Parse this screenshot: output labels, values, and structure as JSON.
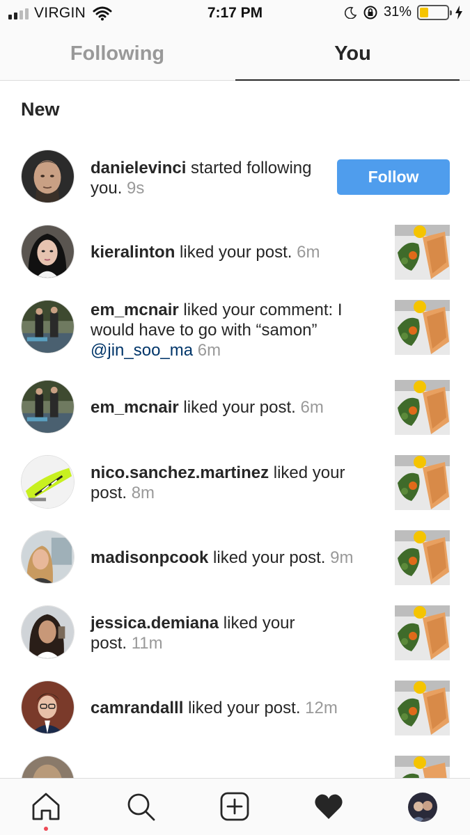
{
  "status_bar": {
    "carrier": "VIRGIN",
    "time": "7:17 PM",
    "battery_percent": "31%",
    "battery_level": 0.31,
    "battery_color": "#f5c400"
  },
  "tabs": {
    "following": "Following",
    "you": "You",
    "active": "You"
  },
  "section_title": "New",
  "notifications": [
    {
      "username": "danielevinci",
      "action": " started following you. ",
      "time": "9s",
      "button": "Follow",
      "avatar_icon": "user-photo",
      "accent": "#4f9ded"
    },
    {
      "username": "kieralinton",
      "action": " liked your post. ",
      "time": "6m",
      "thumb_icon": "food-post-thumbnail"
    },
    {
      "username": "em_mcnair",
      "action": " liked your comment: I would have to go with “samon” ",
      "mention": "@jin_soo_ma",
      "time": "6m",
      "thumb_icon": "food-post-thumbnail"
    },
    {
      "username": "em_mcnair",
      "action": " liked your post. ",
      "time": "6m",
      "thumb_icon": "food-post-thumbnail"
    },
    {
      "username": "nico.sanchez.martinez",
      "action": " liked your post. ",
      "time": "8m",
      "thumb_icon": "food-post-thumbnail"
    },
    {
      "username": "madisonpcook",
      "action": " liked your post. ",
      "time": "9m",
      "thumb_icon": "food-post-thumbnail"
    },
    {
      "username": "jessica.demiana",
      "action": " liked your post. ",
      "time": "11m",
      "thumb_icon": "food-post-thumbnail"
    },
    {
      "username": "camrandalll",
      "action": " liked your post. ",
      "time": "12m",
      "thumb_icon": "food-post-thumbnail"
    }
  ],
  "bottom_nav": [
    {
      "name": "home-icon"
    },
    {
      "name": "search-icon"
    },
    {
      "name": "add-post-icon"
    },
    {
      "name": "heart-icon"
    },
    {
      "name": "profile-avatar"
    }
  ]
}
